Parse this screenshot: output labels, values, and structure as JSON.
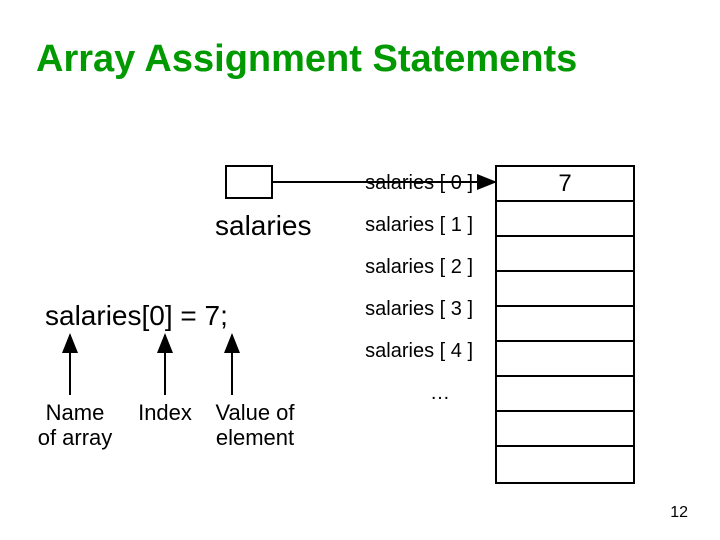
{
  "title": "Array Assignment Statements",
  "array_name": "salaries",
  "index_labels": [
    "salaries [ 0 ]",
    "salaries [ 1 ]",
    "salaries [ 2 ]",
    "salaries [ 3 ]",
    "salaries [ 4 ]",
    "…"
  ],
  "cells": {
    "0": "7",
    "1": "",
    "2": "",
    "3": "",
    "4": "",
    "5": "",
    "6": "",
    "7": "",
    "8": ""
  },
  "assignment": "salaries[0] = 7;",
  "annotations": {
    "name_label_line1": "Name",
    "name_label_line2": "of array",
    "index_label": "Index",
    "value_label_line1": "Value of",
    "value_label_line2": "element"
  },
  "page_number": "12"
}
